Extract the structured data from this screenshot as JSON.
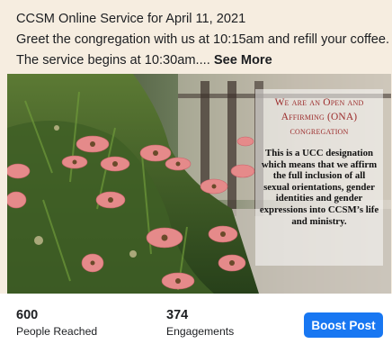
{
  "post": {
    "line1": "CCSM Online Service for April 11, 2021",
    "line2": "Greet the congregation with us at 10:15am and refill your coffee.",
    "line3": "The service begins at 10:30am....",
    "see_more": "See More"
  },
  "image_overlay": {
    "title_line1": "We are an Open and",
    "title_line2": "Affirming (ONA)",
    "title_line3": "congregation",
    "body": "This is a UCC designation which means that we affirm the full inclusion of all sexual orientations, gender identities and gender expressions into CCSM’s life and ministry."
  },
  "stats": {
    "reached_value": "600",
    "reached_label": "People Reached",
    "engagements_value": "374",
    "engagements_label": "Engagements"
  },
  "actions": {
    "boost_label": "Boost Post"
  },
  "colors": {
    "boost_button": "#1877f2",
    "overlay_title": "#9b2a2a",
    "card_background": "#f6ede0"
  }
}
